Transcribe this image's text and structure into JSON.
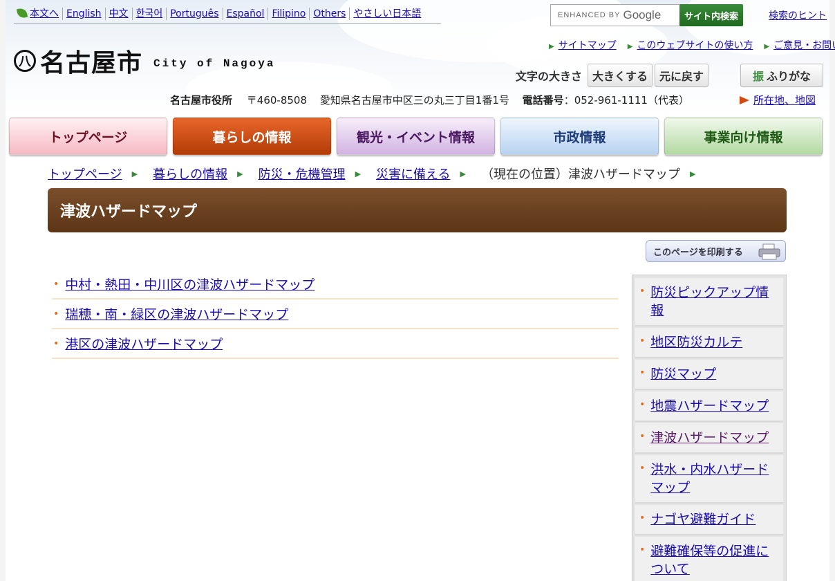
{
  "lang_bar": {
    "items": [
      "本文へ",
      "English",
      "中文",
      "한국어",
      "Português",
      "Español",
      "Filipino",
      "Others",
      "やさしい日本語"
    ]
  },
  "search": {
    "enhanced_label": "ENHANCED BY",
    "google_label": "Google",
    "button_label": "サイト内検索",
    "hint_link": "検索のヒント"
  },
  "logo": {
    "mark": "八",
    "name": "名古屋市",
    "english": "City of Nagoya"
  },
  "util_links": [
    "サイトマップ",
    "このウェブサイトの使い方",
    "ご意見・お問い合せ"
  ],
  "font_size": {
    "label": "文字の大きさ",
    "larger": "大きくする",
    "reset": "元に戻す",
    "furigana": "ふりがな",
    "furigana_icon": "振"
  },
  "address": {
    "office": "名古屋市役所",
    "postal": "〒460-8508",
    "street": "愛知県名古屋市中区三の丸三丁目1番1号",
    "phone_label": "電話番号",
    "phone": "：052-961-1111（代表）",
    "map_link": "所在地、地図"
  },
  "main_nav": [
    "トップページ",
    "暮らしの情報",
    "観光・イベント情報",
    "市政情報",
    "事業向け情報"
  ],
  "breadcrumb": {
    "items": [
      "トップページ",
      "暮らしの情報",
      "防災・危機管理",
      "災害に備える"
    ],
    "current": "（現在の位置）津波ハザードマップ"
  },
  "page_title": "津波ハザードマップ",
  "print_button": "このページを印刷する",
  "main_links": [
    "中村・熱田・中川区の津波ハザードマップ",
    "瑞穂・南・緑区の津波ハザードマップ",
    "港区の津波ハザードマップ"
  ],
  "sidebar": {
    "items": [
      "防災ピックアップ情報",
      "地区防災カルテ",
      "防災マップ",
      "地震ハザードマップ",
      "津波ハザードマップ",
      "洪水・内水ハザードマップ",
      "ナゴヤ避難ガイド",
      "避難確保等の促進について"
    ]
  },
  "colors": {
    "link": "#1a0dab",
    "visited": "#5a1a6a",
    "title_bg": "#6b4320",
    "accent_green": "#3a8a3a",
    "bullet_orange": "#e07020",
    "kurashi_tab": "#c84e10"
  }
}
